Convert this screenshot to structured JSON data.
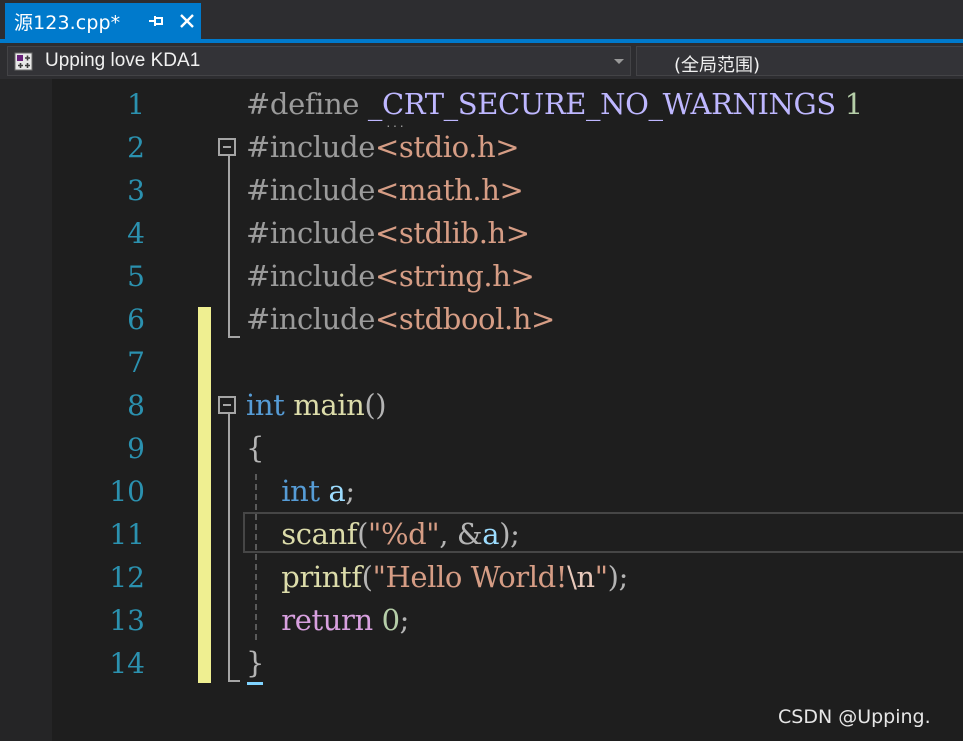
{
  "tab": {
    "title": "源123.cpp*",
    "pin_icon": "pin-icon",
    "close_icon": "close-icon"
  },
  "navbar": {
    "project": "Upping love KDA1",
    "scope": "(全局范围)"
  },
  "editor": {
    "line_numbers": [
      "1",
      "2",
      "3",
      "4",
      "5",
      "6",
      "7",
      "8",
      "9",
      "10",
      "11",
      "12",
      "13",
      "14"
    ],
    "lines": [
      [
        {
          "t": "#define ",
          "c": "pre"
        },
        {
          "t": "_CRT_SECURE_NO_WARNINGS",
          "c": "macro"
        },
        {
          "t": " 1",
          "c": "num"
        }
      ],
      [
        {
          "t": "#include",
          "c": "pre"
        },
        {
          "t": "<stdio.h>",
          "c": "str"
        }
      ],
      [
        {
          "t": "#include",
          "c": "pre"
        },
        {
          "t": "<math.h>",
          "c": "str"
        }
      ],
      [
        {
          "t": "#include",
          "c": "pre"
        },
        {
          "t": "<stdlib.h>",
          "c": "str"
        }
      ],
      [
        {
          "t": "#include",
          "c": "pre"
        },
        {
          "t": "<string.h>",
          "c": "str"
        }
      ],
      [
        {
          "t": "#include",
          "c": "pre"
        },
        {
          "t": "<stdbool.h>",
          "c": "str"
        }
      ],
      [],
      [
        {
          "t": "int",
          "c": "kw"
        },
        {
          "t": " ",
          "c": "punc"
        },
        {
          "t": "main",
          "c": "fn"
        },
        {
          "t": "()",
          "c": "punc"
        }
      ],
      [
        {
          "t": "{",
          "c": "punc"
        }
      ],
      [
        {
          "t": "    ",
          "c": "punc"
        },
        {
          "t": "int",
          "c": "kw"
        },
        {
          "t": " ",
          "c": "punc"
        },
        {
          "t": "a",
          "c": "var"
        },
        {
          "t": ";",
          "c": "punc"
        }
      ],
      [
        {
          "t": "    ",
          "c": "punc"
        },
        {
          "t": "scanf",
          "c": "fn"
        },
        {
          "t": "(",
          "c": "punc"
        },
        {
          "t": "\"%d\"",
          "c": "str"
        },
        {
          "t": ", &",
          "c": "punc"
        },
        {
          "t": "a",
          "c": "var"
        },
        {
          "t": ");",
          "c": "punc"
        }
      ],
      [
        {
          "t": "    ",
          "c": "punc"
        },
        {
          "t": "printf",
          "c": "fn"
        },
        {
          "t": "(",
          "c": "punc"
        },
        {
          "t": "\"Hello World!",
          "c": "str"
        },
        {
          "t": "\\n",
          "c": "esc"
        },
        {
          "t": "\"",
          "c": "str"
        },
        {
          "t": ");",
          "c": "punc"
        }
      ],
      [
        {
          "t": "    ",
          "c": "punc"
        },
        {
          "t": "return",
          "c": "ctl"
        },
        {
          "t": " ",
          "c": "punc"
        },
        {
          "t": "0",
          "c": "num"
        },
        {
          "t": ";",
          "c": "punc"
        }
      ],
      [
        {
          "t": "}",
          "c": "punc"
        }
      ]
    ],
    "current_line": 11
  },
  "watermark": "CSDN @Upping.",
  "colors": {
    "accent": "#007acc",
    "change_bar": "#efef91",
    "line_number": "#2b91af"
  }
}
